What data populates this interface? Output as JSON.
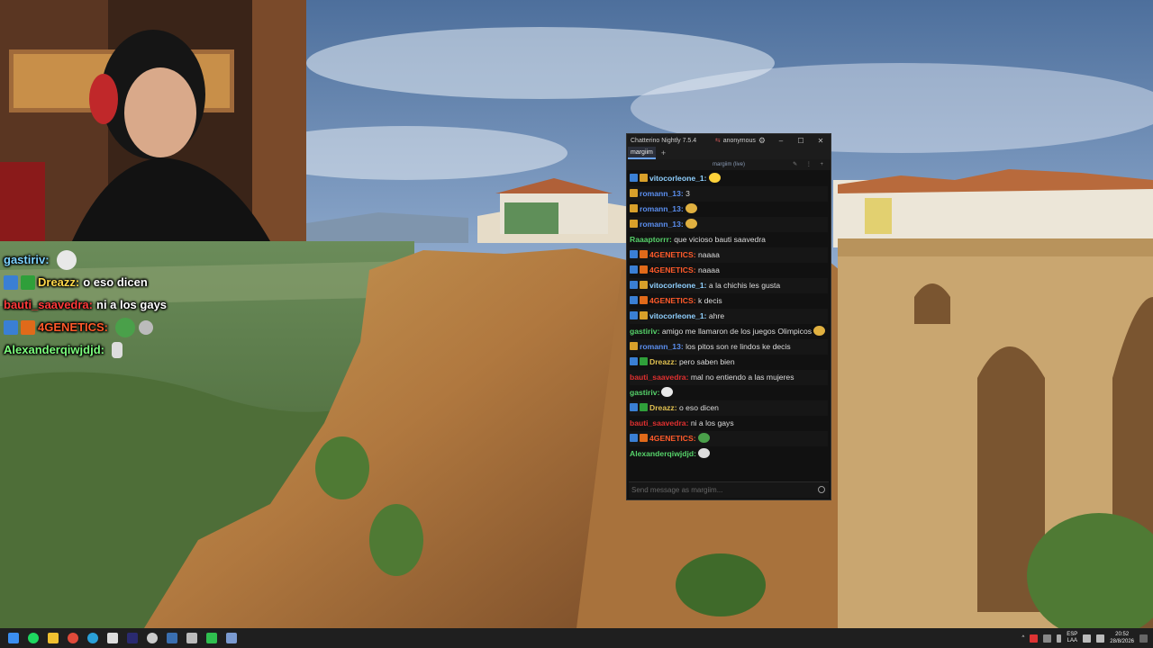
{
  "webcam": {
    "caption": ""
  },
  "overlay_chat": [
    {
      "user": "gastiriv:",
      "color": "#7dd3ff",
      "text": "",
      "badges": [],
      "emotes": [
        "#e8e8e8"
      ]
    },
    {
      "user": "Dreazz:",
      "color": "#ffd84a",
      "text": "o eso dicen",
      "badges": [
        "#3a7fd4",
        "#2f9f3a"
      ],
      "emotes": []
    },
    {
      "user": "bauti_saavedra:",
      "color": "#ff3a3a",
      "text": "ni a los gays",
      "badges": [],
      "emotes": []
    },
    {
      "user": "4GENETICS:",
      "color": "#ff5a2a",
      "text": "",
      "badges": [
        "#3a7fd4",
        "#e06a1a"
      ],
      "emotes": [
        "#4aa04a",
        "#bbbbbb"
      ]
    },
    {
      "user": "Alexanderqiwjdjd:",
      "color": "#7dff7d",
      "text": "",
      "badges": [],
      "emotes": [
        "#dddddd"
      ]
    }
  ],
  "chatterino": {
    "app_title": "Chatterino Nightly 7.5.4",
    "account": "anonymous",
    "window_controls": [
      "–",
      "☐",
      "✕"
    ],
    "tab_label": "margiim",
    "tab_add": "+",
    "split_header": "margiim (live)",
    "input_placeholder": "Send message as margiim...",
    "messages": [
      {
        "user": "vitocorleone_1:",
        "color": "#8fd0ff",
        "text": "",
        "badges": [
          "prime",
          "sub"
        ],
        "emote": "#ffd23a"
      },
      {
        "user": "romann_13:",
        "color": "#5b8ff0",
        "text": "3",
        "badges": [
          "sub"
        ],
        "emote": ""
      },
      {
        "user": "romann_13:",
        "color": "#5b8ff0",
        "text": "",
        "badges": [
          "sub"
        ],
        "emote": "#e0b040"
      },
      {
        "user": "romann_13:",
        "color": "#5b8ff0",
        "text": "",
        "badges": [
          "sub"
        ],
        "emote": "#e0b040"
      },
      {
        "user": "Raaaptorrr:",
        "color": "#56d26a",
        "text": "que vicioso bauti saavedra",
        "badges": [],
        "emote": ""
      },
      {
        "user": "4GENETICS:",
        "color": "#ff5a2a",
        "text": "naaaa",
        "badges": [
          "prime",
          "orange"
        ],
        "emote": ""
      },
      {
        "user": "4GENETICS:",
        "color": "#ff5a2a",
        "text": "naaaa",
        "badges": [
          "prime",
          "orange"
        ],
        "emote": ""
      },
      {
        "user": "vitocorleone_1:",
        "color": "#8fd0ff",
        "text": "a la chichis les gusta",
        "badges": [
          "prime",
          "sub"
        ],
        "emote": ""
      },
      {
        "user": "4GENETICS:",
        "color": "#ff5a2a",
        "text": "k decis",
        "badges": [
          "prime",
          "orange"
        ],
        "emote": ""
      },
      {
        "user": "vitocorleone_1:",
        "color": "#8fd0ff",
        "text": "ahre",
        "badges": [
          "prime",
          "sub"
        ],
        "emote": ""
      },
      {
        "user": "gastiriv:",
        "color": "#56d26a",
        "text": "amigo me llamaron de los juegos Olimpicos",
        "badges": [],
        "emote": "#e0b040"
      },
      {
        "user": "romann_13:",
        "color": "#5b8ff0",
        "text": "los pitos son re lindos ke decis",
        "badges": [
          "sub"
        ],
        "emote": ""
      },
      {
        "user": "Dreazz:",
        "color": "#e0c050",
        "text": "pero saben bien",
        "badges": [
          "prime",
          "mod"
        ],
        "emote": ""
      },
      {
        "user": "bauti_saavedra:",
        "color": "#e03030",
        "text": "mal no entiendo a las mujeres",
        "badges": [],
        "emote": ""
      },
      {
        "user": "gastiriv:",
        "color": "#56d26a",
        "text": "",
        "badges": [],
        "emote": "#e8e8e8"
      },
      {
        "user": "Dreazz:",
        "color": "#e0c050",
        "text": "o eso dicen",
        "badges": [
          "prime",
          "mod"
        ],
        "emote": ""
      },
      {
        "user": "bauti_saavedra:",
        "color": "#e03030",
        "text": "ni a los gays",
        "badges": [],
        "emote": ""
      },
      {
        "user": "4GENETICS:",
        "color": "#ff5a2a",
        "text": "",
        "badges": [
          "prime",
          "orange"
        ],
        "emote": "#4aa04a"
      },
      {
        "user": "Alexanderqiwjdjd:",
        "color": "#56d26a",
        "text": "",
        "badges": [],
        "emote": "#dddddd"
      }
    ]
  },
  "taskbar": {
    "apps": [
      "start-icon",
      "spotify-icon",
      "explorer-icon",
      "chrome-icon",
      "edge-icon",
      "notepad-icon",
      "premiere-icon",
      "obs-icon",
      "steam-icon",
      "steam2-icon",
      "terminal-icon",
      "chatterino-icon"
    ],
    "app_colors": [
      "#3b8ef0",
      "#1ed760",
      "#f0c030",
      "#e04a3a",
      "#2aa0d8",
      "#dddddd",
      "#2a2a70",
      "#cccccc",
      "#3a6fb0",
      "#bbbbbb",
      "#2fbf4f",
      "#7a9ad0"
    ],
    "lang_top": "ESP",
    "lang_bottom": "LAA",
    "time": "20:52",
    "date": "28/8/2026"
  }
}
